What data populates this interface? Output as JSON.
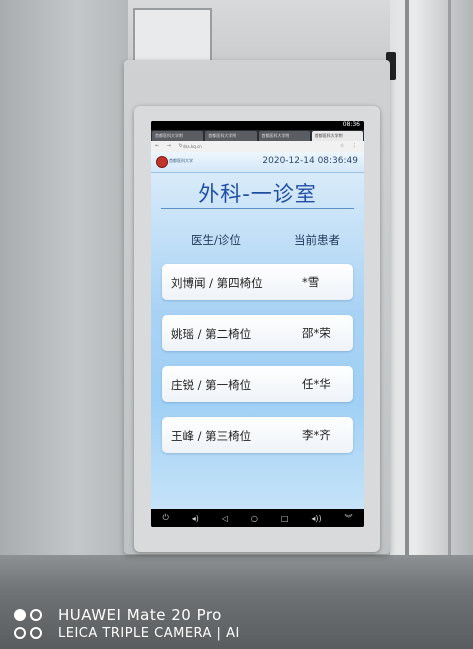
{
  "browser": {
    "status_time": "08:36",
    "tabs": [
      "首都医科大学附",
      "首都医科大学附",
      "首都医科大学附",
      "首都医科大学附"
    ],
    "url": "dss.kq.cn"
  },
  "display": {
    "org_name": "首都医科大学",
    "datetime": "2020-12-14 08:36:49",
    "room_title": "外科-一诊室",
    "column_headers": {
      "doctor_seat": "医生/诊位",
      "current_patient": "当前患者"
    },
    "rows": [
      {
        "doctor_seat": "刘博闻 / 第四椅位",
        "patient": "*雪"
      },
      {
        "doctor_seat": "姚瑶 / 第二椅位",
        "patient": "邵*荣"
      },
      {
        "doctor_seat": "庄锐 / 第一椅位",
        "patient": "任*华"
      },
      {
        "doctor_seat": "王峰 / 第三椅位",
        "patient": "李*齐"
      }
    ]
  },
  "navbar_icons": [
    "power-icon",
    "volume-down-icon",
    "back-icon",
    "home-icon",
    "recents-icon",
    "volume-up-icon",
    "chevron-down-icon"
  ],
  "camera_watermark": {
    "line1": "HUAWEI Mate 20 Pro",
    "line2": "LEICA TRIPLE CAMERA | AI"
  }
}
